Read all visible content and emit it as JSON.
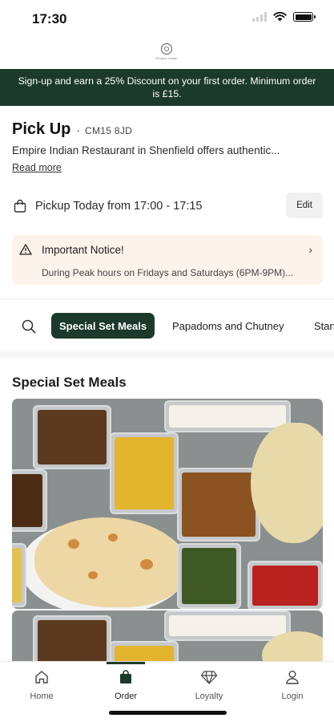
{
  "status_bar": {
    "time": "17:30"
  },
  "logo": {
    "name": "Empire Indian"
  },
  "promo": {
    "text": "Sign-up and earn a 25% Discount on your first order. Minimum order is £15."
  },
  "pickup": {
    "title": "Pick Up",
    "separator": "·",
    "postcode": "CM15 8JD",
    "description": "Empire Indian Restaurant in Shenfield offers authentic...",
    "read_more": "Read more",
    "time_text": "Pickup Today from 17:00 - 17:15",
    "edit_label": "Edit"
  },
  "notice": {
    "title": "Important Notice!",
    "text": "During Peak hours on Fridays and Saturdays (6PM-9PM)...",
    "chevron": "›"
  },
  "categories": {
    "items": [
      "Special Set Meals",
      "Papadoms and Chutney",
      "Starters"
    ],
    "active": "Special Set Meals"
  },
  "section": {
    "title": "Special Set Meals"
  },
  "tab_bar": {
    "tabs": [
      {
        "label": "Home",
        "icon": "home-icon"
      },
      {
        "label": "Order",
        "icon": "bag-icon"
      },
      {
        "label": "Loyalty",
        "icon": "diamond-icon"
      },
      {
        "label": "Login",
        "icon": "person-icon"
      }
    ],
    "active": "Order"
  },
  "colors": {
    "brand_dark_green": "#1b3a2c",
    "notice_bg": "#fdf3ea"
  }
}
